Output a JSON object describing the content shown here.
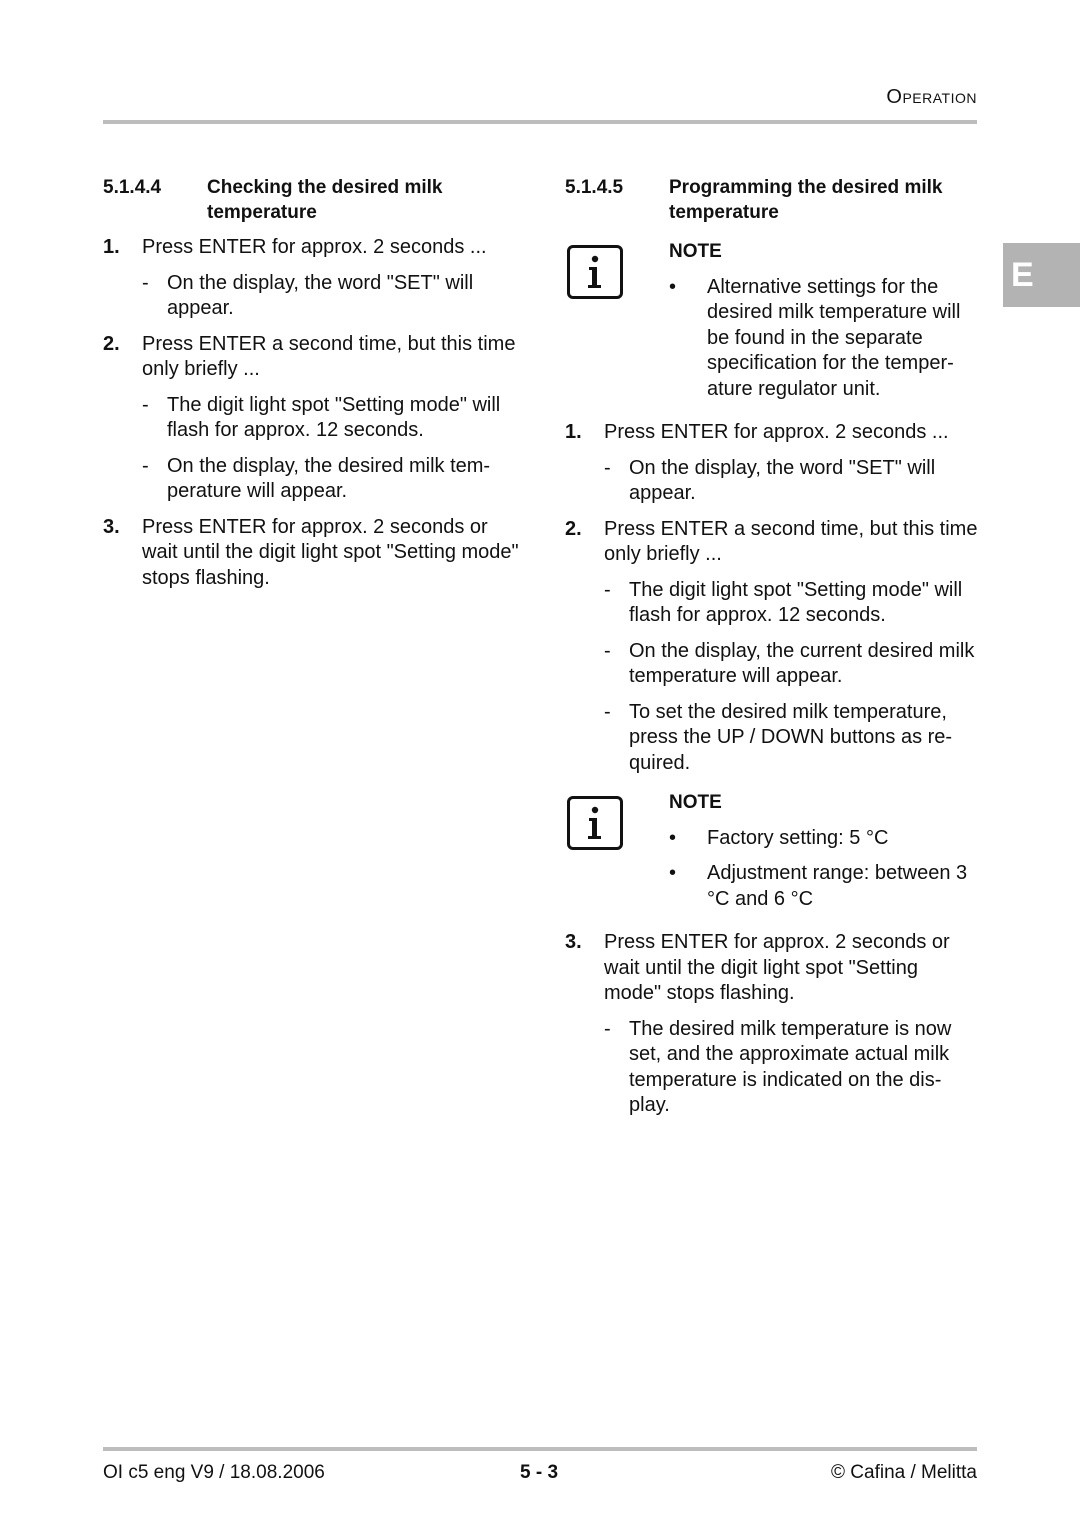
{
  "header": {
    "section_title": "Operation"
  },
  "lang_tab": "E",
  "left": {
    "section_number": "5.1.4.4",
    "section_title": "Checking the desired milk temperature",
    "steps": [
      {
        "num": "1.",
        "text": "Press ENTER for approx. 2 seconds ...",
        "subs": [
          "On the display, the word \"SET\" will appear."
        ]
      },
      {
        "num": "2.",
        "text": "Press ENTER a second time, but this time only briefly ...",
        "subs": [
          "The digit light spot \"Setting mode\" will flash for approx. 12 seconds.",
          "On the display, the desired milk tem-perature will appear."
        ]
      },
      {
        "num": "3.",
        "text": "Press ENTER for approx. 2 seconds or wait until the digit light spot \"Setting mode\" stops flashing.",
        "subs": []
      }
    ]
  },
  "right": {
    "section_number": "5.1.4.5",
    "section_title": "Programming the desired milk temperature",
    "note1": {
      "icon": "info-icon",
      "title": "NOTE",
      "bullet_symbol": "•",
      "bullets": [
        "Alternative settings for the desired milk temperature will be found in the separate specification for the temper-ature regulator unit."
      ]
    },
    "steps": [
      {
        "num": "1.",
        "text": "Press ENTER for approx. 2 seconds ...",
        "subs": [
          "On the display, the word \"SET\" will appear."
        ]
      },
      {
        "num": "2.",
        "text": "Press ENTER a second time, but this time only briefly ...",
        "subs": [
          "The digit light spot \"Setting mode\" will flash for approx. 12 seconds.",
          "On the display, the current desired milk temperature will appear.",
          "To set the desired milk temperature, press the UP / DOWN buttons as re-quired."
        ]
      }
    ],
    "note2": {
      "icon": "info-icon",
      "title": "NOTE",
      "bullet_symbol": "•",
      "bullets": [
        "Factory setting: 5 °C",
        "Adjustment range: between 3 °C and 6 °C"
      ]
    },
    "steps_after": [
      {
        "num": "3.",
        "text": "Press ENTER for approx. 2 seconds or wait until the digit light spot \"Setting mode\" stops flashing.",
        "subs": [
          "The desired milk temperature is now set, and the approximate actual milk temperature is indicated on the dis-play."
        ]
      }
    ]
  },
  "footer": {
    "left": "OI c5 eng V9 / 18.08.2006",
    "center": "5 - 3",
    "right": "© Cafina / Melitta"
  },
  "sub_dash": "-"
}
